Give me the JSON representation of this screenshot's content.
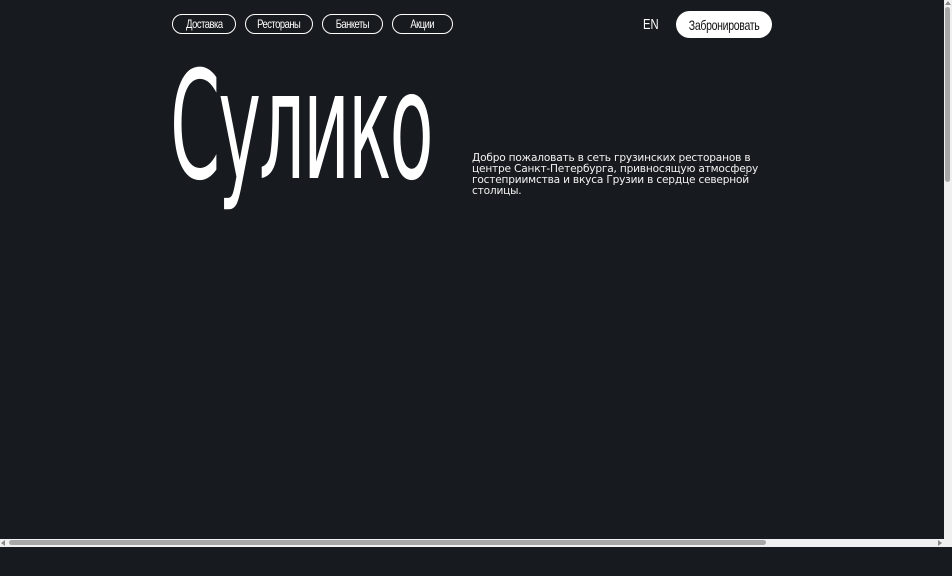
{
  "nav": {
    "items": [
      {
        "label": "Доставка"
      },
      {
        "label": "Рестораны"
      },
      {
        "label": "Банкеты"
      },
      {
        "label": "Акции"
      }
    ]
  },
  "header": {
    "lang": "EN",
    "book_label": "Забронировать"
  },
  "hero": {
    "title": "Сулико",
    "intro": "Добро пожаловать в сеть грузинских ресторанов в центре Санкт-Петербурга, привносящую атмосферу гостеприимства и вкуса Грузии в сердце северной столицы."
  },
  "colors": {
    "background": "#171a1e",
    "text": "#ffffff",
    "button_bg": "#ffffff",
    "button_text": "#111111"
  }
}
